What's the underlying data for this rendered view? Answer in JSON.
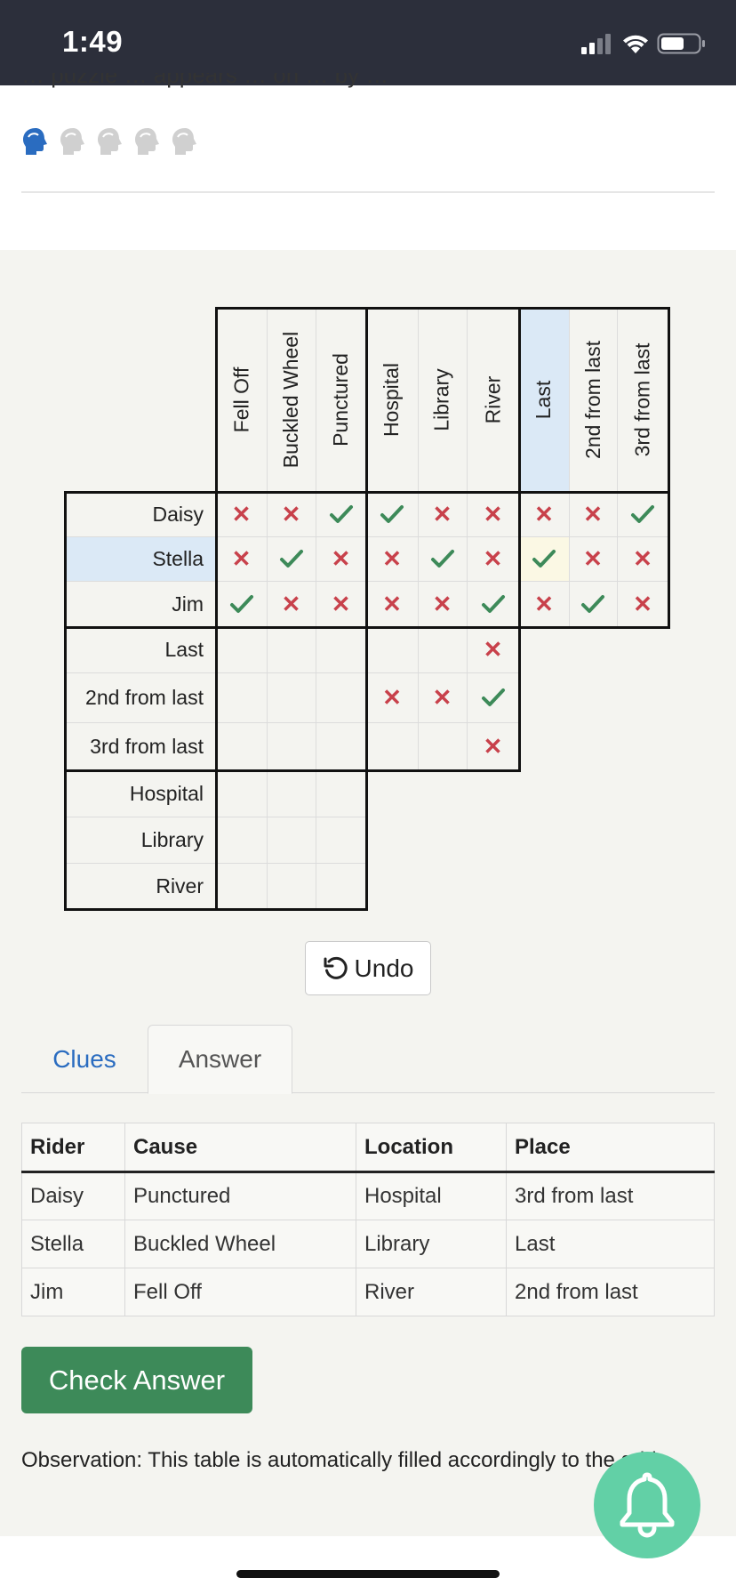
{
  "status_bar": {
    "time": "1:49",
    "icons": [
      "cellular-signal-icon",
      "wifi-icon",
      "battery-icon"
    ]
  },
  "header": {
    "partial_text": "… puzzle … appears … on … by …",
    "difficulty": {
      "filled": 1,
      "total": 5,
      "icon": "head-icon",
      "filled_color": "#2a6cc0",
      "empty_color": "#d0d0d0"
    }
  },
  "grid": {
    "column_groups": [
      {
        "name": "Cause",
        "labels": [
          "Fell Off",
          "Buckled Wheel",
          "Punctured"
        ]
      },
      {
        "name": "Location",
        "labels": [
          "Hospital",
          "Library",
          "River"
        ]
      },
      {
        "name": "Place",
        "labels": [
          "Last",
          "2nd from last",
          "3rd from last"
        ]
      }
    ],
    "row_groups": [
      {
        "name": "Rider",
        "labels": [
          "Daisy",
          "Stella",
          "Jim"
        ]
      },
      {
        "name": "Place",
        "labels": [
          "Last",
          "2nd from last",
          "3rd from last"
        ]
      },
      {
        "name": "Location",
        "labels": [
          "Hospital",
          "Library",
          "River"
        ]
      }
    ],
    "highlighted_column": "Last",
    "highlighted_row": "Stella",
    "marks": [
      [
        "x",
        "x",
        "v",
        "v",
        "x",
        "x",
        "x",
        "x",
        "v"
      ],
      [
        "x",
        "v",
        "x",
        "x",
        "v",
        "x",
        "v",
        "x",
        "x"
      ],
      [
        "v",
        "x",
        "x",
        "x",
        "x",
        "v",
        "x",
        "v",
        "x"
      ],
      [
        "",
        "",
        "",
        "",
        "",
        "x"
      ],
      [
        "",
        "",
        "",
        "x",
        "x",
        "v"
      ],
      [
        "",
        "",
        "",
        "",
        "",
        "x"
      ],
      [
        "",
        "",
        ""
      ],
      [
        "",
        "",
        ""
      ],
      [
        "",
        "",
        ""
      ]
    ],
    "x_glyph": "✕",
    "x_color": "#c8414b",
    "check_color": "#3d8a59"
  },
  "undo": {
    "label": "Undo",
    "icon": "undo-icon"
  },
  "tabs": [
    {
      "label": "Clues",
      "active": false
    },
    {
      "label": "Answer",
      "active": true
    }
  ],
  "answer_table": {
    "headers": [
      "Rider",
      "Cause",
      "Location",
      "Place"
    ],
    "rows": [
      [
        "Daisy",
        "Punctured",
        "Hospital",
        "3rd from last"
      ],
      [
        "Stella",
        "Buckled Wheel",
        "Library",
        "Last"
      ],
      [
        "Jim",
        "Fell Off",
        "River",
        "2nd from last"
      ]
    ]
  },
  "check_button": {
    "label": "Check Answer",
    "color": "#3d8a59"
  },
  "observation": "Observation: This table is automatically filled accordingly to the grid.",
  "notification": {
    "icon": "bell-icon",
    "color": "#62d0a6"
  }
}
